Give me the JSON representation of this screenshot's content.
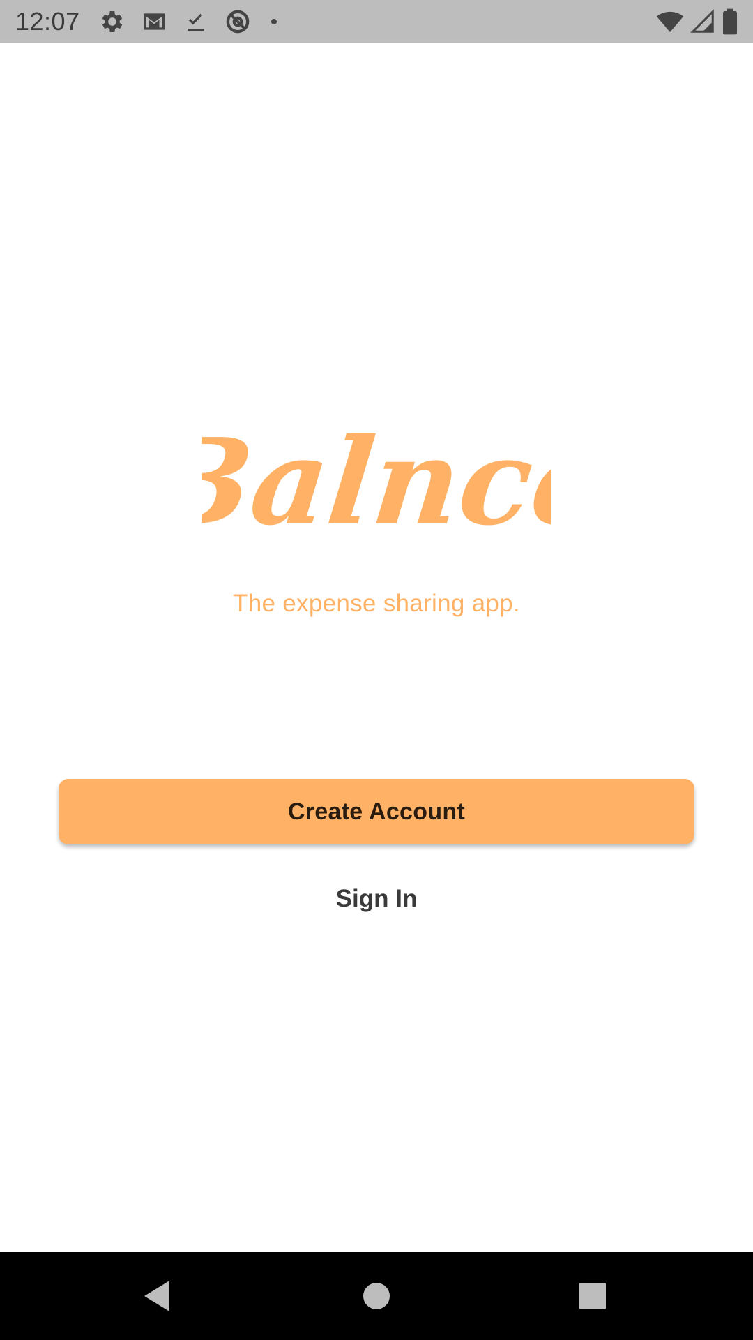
{
  "status_bar": {
    "time": "12:07",
    "left_icons": [
      "settings-icon",
      "gmail-icon",
      "download-done-icon",
      "sync-disabled-icon",
      "dot-icon"
    ],
    "right_icons": [
      "wifi-icon",
      "cell-signal-icon",
      "battery-icon"
    ]
  },
  "app": {
    "logo_text": "Balnce",
    "tagline": "The expense sharing app.",
    "accent_color": "#ffb166"
  },
  "actions": {
    "create_account_label": "Create Account",
    "sign_in_label": "Sign In"
  },
  "nav_bar": {
    "buttons": [
      "back-icon",
      "home-icon",
      "recents-icon"
    ]
  }
}
